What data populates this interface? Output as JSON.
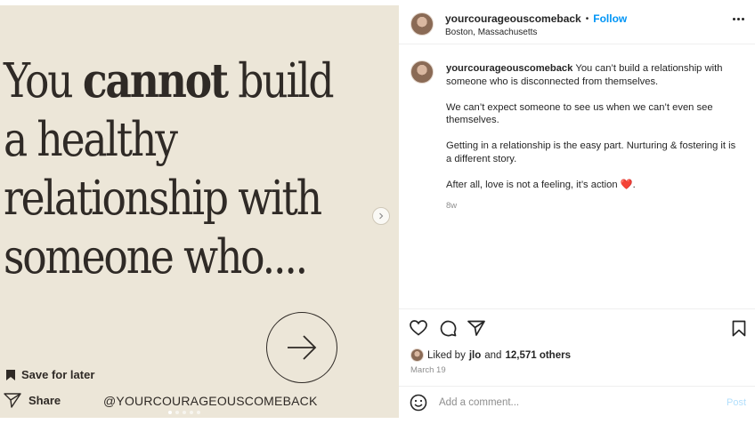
{
  "media": {
    "headline": {
      "line1_pre": "You ",
      "line1_bold": "cannot",
      "line1_post": " build",
      "line2": "a healthy",
      "line3": "relationship with",
      "line4": "someone who...."
    },
    "save_label": "Save for later",
    "share_label": "Share",
    "watermark": "@YOURCOURAGEOUSCOMEBACK",
    "carousel_count": 5,
    "carousel_active_index": 0,
    "background_color": "#ece6d8"
  },
  "post": {
    "username": "yourcourageouscomeback",
    "separator": "•",
    "follow_label": "Follow",
    "location": "Boston, Massachusetts",
    "caption": {
      "p1": "You can’t build a relationship with someone who is disconnected from themselves.",
      "p2": "We can’t expect someone to see us when we can’t even see themselves.",
      "p3": "Getting in a relationship is the easy part. Nurturing & fostering it is a different story.",
      "p4": "After all, love is not a feeling, it’s action ",
      "p4_emoji": "❤️",
      "p4_end": ".",
      "time_ago": "8w"
    },
    "likes": {
      "prefix": "Liked by ",
      "user": "jlo",
      "middle": " and ",
      "count": "12,571 others"
    },
    "date": "March 19",
    "comment": {
      "placeholder": "Add a comment...",
      "post_label": "Post"
    }
  },
  "colors": {
    "link_blue": "#0095f6",
    "post_disabled": "#b2dffc",
    "heart_red": "#d0021b"
  },
  "icons": [
    "bookmark-icon",
    "share-icon",
    "arrow-right-icon",
    "chevron-right-icon",
    "more-icon",
    "heart-icon",
    "comment-icon",
    "send-icon",
    "emoji-icon"
  ]
}
